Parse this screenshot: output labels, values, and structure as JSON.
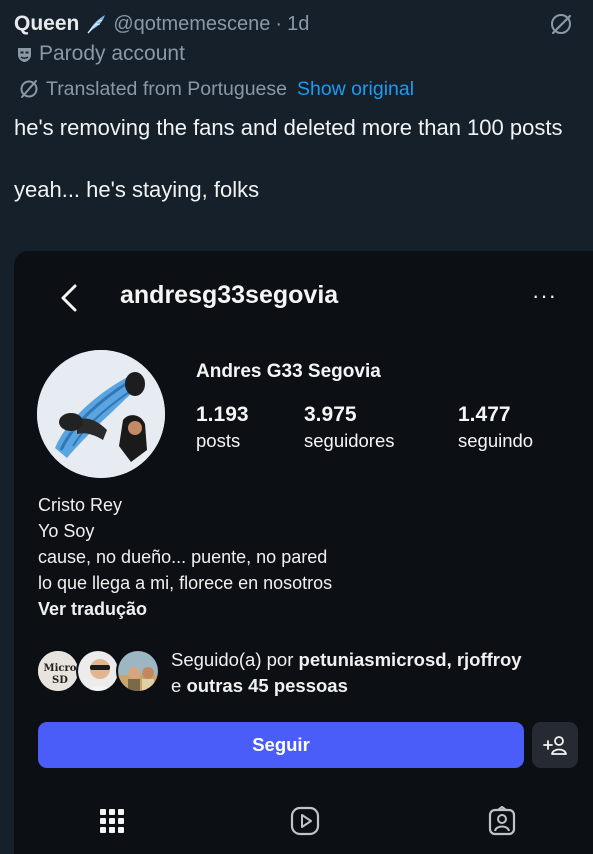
{
  "tweet": {
    "author": "Queen",
    "handle": "@qotmemescene",
    "separator": "·",
    "time": "1d",
    "parody_label": "Parody account",
    "translated_label": "Translated from Portuguese",
    "show_original": "Show original",
    "text_line1": "he's removing the fans and deleted more than 100 posts",
    "text_line2": "yeah... he's staying, folks",
    "icons": [
      "feather-icon",
      "grok-icon",
      "parody-mask-icon",
      "translate-icon"
    ],
    "colors": {
      "background": "#15202b",
      "link": "#1d9bf0",
      "muted": "#8b98a5"
    }
  },
  "instagram": {
    "username": "andresg33segovia",
    "more": "···",
    "full_name": "Andres G33 Segovia",
    "stats": {
      "posts": {
        "value": "1.193",
        "label": "posts"
      },
      "followers": {
        "value": "3.975",
        "label": "seguidores"
      },
      "following": {
        "value": "1.477",
        "label": "seguindo"
      }
    },
    "bio": [
      "Cristo Rey",
      "Yo Soy",
      "cause, no dueño... puente, no pared",
      "lo que llega a mi, florece en nosotros"
    ],
    "see_translation": "Ver tradução",
    "followed_by": {
      "prefix": "Seguido(a) por ",
      "names": "petuniasmicrosd, rjoffroy",
      "line2_prefix": "e ",
      "others": "outras 45 pessoas",
      "avatar_text": "Micro SD"
    },
    "follow_button": "Seguir",
    "add_user_icon": "+person-icon",
    "tabs": [
      "grid-icon",
      "reels-icon",
      "tagged-icon"
    ],
    "colors": {
      "background": "#0c0f14",
      "follow_button": "#4a5df9",
      "secondary_button": "#262a33"
    }
  }
}
